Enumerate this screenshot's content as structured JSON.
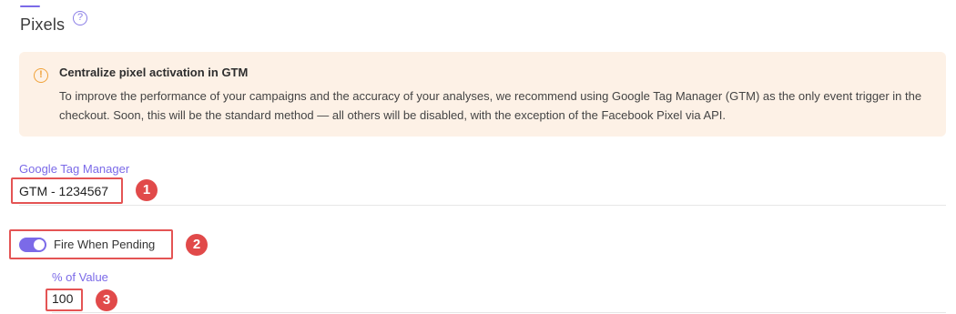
{
  "section": {
    "title": "Pixels",
    "help_icon": "question-circle-icon"
  },
  "alert": {
    "icon": "warning-circle-icon",
    "title": "Centralize pixel activation in GTM",
    "body": "To improve the performance of your campaigns and the accuracy of your analyses, we recommend using Google Tag Manager (GTM) as the only event trigger in the checkout. Soon, this will be the standard method — all others will be disabled, with the exception of the Facebook Pixel via API.",
    "background_color": "#fdf1e6",
    "icon_color": "#f0a23a"
  },
  "gtm": {
    "label": "Google Tag Manager",
    "value": "GTM - 1234567",
    "annotation": "1"
  },
  "fire_when_pending": {
    "label": "Fire When Pending",
    "enabled": true,
    "annotation": "2"
  },
  "percent_value": {
    "label": "% of Value",
    "value": "100",
    "annotation": "3"
  },
  "colors": {
    "accent": "#7b6ae8",
    "highlight": "#e45454",
    "badge": "#e14a4a"
  }
}
